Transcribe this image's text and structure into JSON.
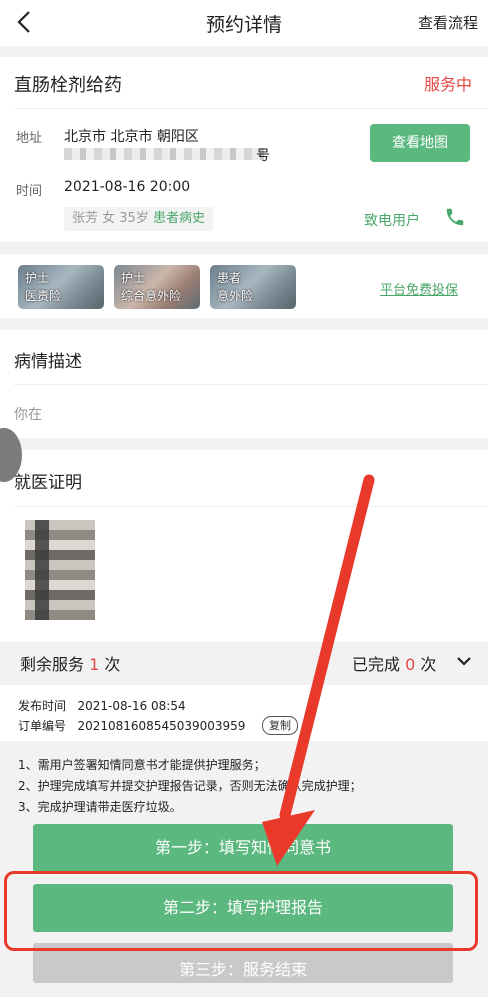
{
  "nav": {
    "title": "预约详情",
    "right_link": "查看流程"
  },
  "service": {
    "name": "直肠栓剂给药",
    "status": "服务中",
    "address_label": "地址",
    "address": "北京市 北京市 朝阳区",
    "address_tail": "号",
    "map_button": "查看地图",
    "time_label": "时间",
    "time": "2021-08-16 20:00",
    "patient_info": "张芳 女 35岁",
    "patient_history_link": "患者病史",
    "call_user": "致电用户"
  },
  "insurance": {
    "badges": [
      {
        "line1": "护士",
        "line2": "医责险"
      },
      {
        "line1": "护士",
        "line2": "综合意外险"
      },
      {
        "line1": "患者",
        "line2": "意外险"
      }
    ],
    "link": "平台免费投保"
  },
  "condition": {
    "title": "病情描述",
    "text": "你在"
  },
  "medical_proof": {
    "title": "就医证明"
  },
  "remaining": {
    "label": "剩余服务",
    "count": "1",
    "unit": "次",
    "done_label": "已完成",
    "done_count": "0",
    "done_unit": "次"
  },
  "order": {
    "publish_label": "发布时间",
    "publish_time": "2021-08-16 08:54",
    "order_label": "订单编号",
    "order_no": "20210816085450390039​59",
    "copy": "复制"
  },
  "notes": [
    "1、需用户签署知情同意书才能提供护理服务；",
    "2、护理完成填写并提交护理报告记录，否则无法确认完成护理；",
    "3、完成护理请带走医疗垃圾。"
  ],
  "steps": {
    "step1": "第一步：填写知情同意书",
    "step2": "第二步：填写护理报告",
    "step3": "第三步：服务结束"
  },
  "colors": {
    "accent_green": "#5bb87e",
    "status_red": "#e24a44",
    "annotation_red": "#e8392a"
  }
}
